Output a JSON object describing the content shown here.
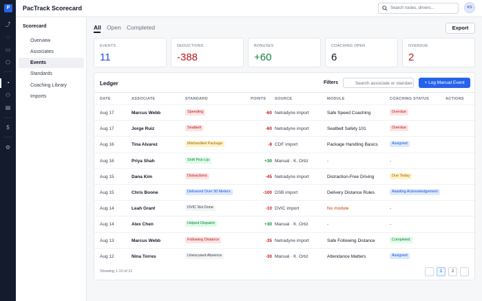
{
  "app": {
    "logo_letter": "P",
    "title": "PacTrack Scorecard"
  },
  "search": {
    "placeholder": "Search routes, drivers..."
  },
  "user": {
    "initials": "KS"
  },
  "nav": {
    "title": "Scorecard",
    "items": [
      {
        "label": "Overview"
      },
      {
        "label": "Associates"
      },
      {
        "label": "Events",
        "active": true
      },
      {
        "label": "Standards"
      },
      {
        "label": "Coaching Library"
      },
      {
        "label": "Imports"
      }
    ]
  },
  "tabs": [
    {
      "label": "All",
      "active": true
    },
    {
      "label": "Open"
    },
    {
      "label": "Completed"
    }
  ],
  "export_label": "Export",
  "summary": [
    {
      "label": "EVENTS",
      "value": "11",
      "color": "#1d4ed8"
    },
    {
      "label": "DEDUCTIONS",
      "value": "-388",
      "color": "#b91c1c"
    },
    {
      "label": "BONUSES",
      "value": "+60",
      "color": "#15803d"
    },
    {
      "label": "COACHING OPEN",
      "value": "6",
      "color": "#111827"
    },
    {
      "label": "OVERDUE",
      "value": "2",
      "color": "#b91c1c"
    }
  ],
  "ledger": {
    "title": "Ledger",
    "filters_label": "Filters",
    "search_placeholder": "Search associate or standard",
    "log_button": "+ Log Manual Event",
    "columns": [
      "DATE",
      "ASSOCIATE",
      "STANDARD",
      "POINTS",
      "SOURCE",
      "MODULE",
      "COACHING STATUS",
      "ACTIONS"
    ],
    "rows": [
      {
        "date": "Aug 17",
        "associate": "Marcus Webb",
        "standard": "Speeding",
        "standard_color": "#b91c1c",
        "standard_bg": "#fde2e2",
        "points": "-60",
        "points_color": "#b91c1c",
        "source": "Netradyne import",
        "module": "Safe Speed Coaching",
        "module_color": "#111827",
        "status": "Overdue",
        "status_color": "#b91c1c",
        "status_bg": "#fde2e2"
      },
      {
        "date": "Aug 17",
        "associate": "Jorge Ruiz",
        "standard": "Seatbelt",
        "standard_color": "#b91c1c",
        "standard_bg": "#fde2e2",
        "points": "-60",
        "points_color": "#b91c1c",
        "source": "Netradyne import",
        "module": "Seatbelt Safety 101",
        "module_color": "#111827",
        "status": "Overdue",
        "status_color": "#b91c1c",
        "status_bg": "#fde2e2"
      },
      {
        "date": "Aug 16",
        "associate": "Tina Alvarez",
        "standard": "Mishandled Package",
        "standard_color": "#a16207",
        "standard_bg": "#fef3c7",
        "points": "-8",
        "points_color": "#b91c1c",
        "source": "CDF import",
        "module": "Package Handling Basics",
        "module_color": "#111827",
        "status": "Assigned",
        "status_color": "#1d4ed8",
        "status_bg": "#dbeafe"
      },
      {
        "date": "Aug 16",
        "associate": "Priya Shah",
        "standard": "Shift Pick-Up",
        "standard_color": "#15803d",
        "standard_bg": "#dcfce7",
        "points": "+30",
        "points_color": "#15803d",
        "source": "Manual · K. Ortiz",
        "module": "-",
        "module_color": "#374151",
        "status": "-",
        "status_color": "#374151",
        "status_bg": ""
      },
      {
        "date": "Aug 15",
        "associate": "Dana Kim",
        "standard": "Distractions",
        "standard_color": "#b91c1c",
        "standard_bg": "#fde2e2",
        "points": "-45",
        "points_color": "#b91c1c",
        "source": "Netradyne import",
        "module": "Distraction-Free Driving",
        "module_color": "#111827",
        "status": "Due Today",
        "status_color": "#a16207",
        "status_bg": "#fef3c7"
      },
      {
        "date": "Aug 15",
        "associate": "Chris Boone",
        "standard": "Delivered Over 50 Meters",
        "standard_color": "#1d4ed8",
        "standard_bg": "#dbeafe",
        "points": "-100",
        "points_color": "#b91c1c",
        "source": "DSB import",
        "module": "Delivery Distance Rules",
        "module_color": "#111827",
        "status": "Awaiting Acknowledgement",
        "status_color": "#1d4ed8",
        "status_bg": "#dbeafe"
      },
      {
        "date": "Aug 14",
        "associate": "Leah Grant",
        "standard": "DVIC Not Done",
        "standard_color": "#374151",
        "standard_bg": "#f3f4f6",
        "points": "-10",
        "points_color": "#b91c1c",
        "source": "DVIC import",
        "module": "No module",
        "module_color": "#c2410c",
        "status": "-",
        "status_color": "#374151",
        "status_bg": ""
      },
      {
        "date": "Aug 14",
        "associate": "Alex Chen",
        "standard": "Helped Dispatch",
        "standard_color": "#15803d",
        "standard_bg": "#dcfce7",
        "points": "+30",
        "points_color": "#15803d",
        "source": "Manual · K. Ortiz",
        "module": "-",
        "module_color": "#374151",
        "status": "-",
        "status_color": "#374151",
        "status_bg": ""
      },
      {
        "date": "Aug 13",
        "associate": "Marcus Webb",
        "standard": "Following Distance",
        "standard_color": "#b91c1c",
        "standard_bg": "#fde2e2",
        "points": "-35",
        "points_color": "#b91c1c",
        "source": "Netradyne import",
        "module": "Safe Following Distance",
        "module_color": "#111827",
        "status": "Completed",
        "status_color": "#15803d",
        "status_bg": "#dcfce7"
      },
      {
        "date": "Aug 12",
        "associate": "Nina Torres",
        "standard": "Unexcused Absence",
        "standard_color": "#374151",
        "standard_bg": "#f3f4f6",
        "points": "-30",
        "points_color": "#b91c1c",
        "source": "Manual · K. Ortiz",
        "module": "Attendance Matters",
        "module_color": "#111827",
        "status": "Assigned",
        "status_color": "#1d4ed8",
        "status_bg": "#dbeafe"
      }
    ],
    "footer": "Showing 1-10 of 11",
    "pages": [
      "1",
      "2"
    ]
  }
}
